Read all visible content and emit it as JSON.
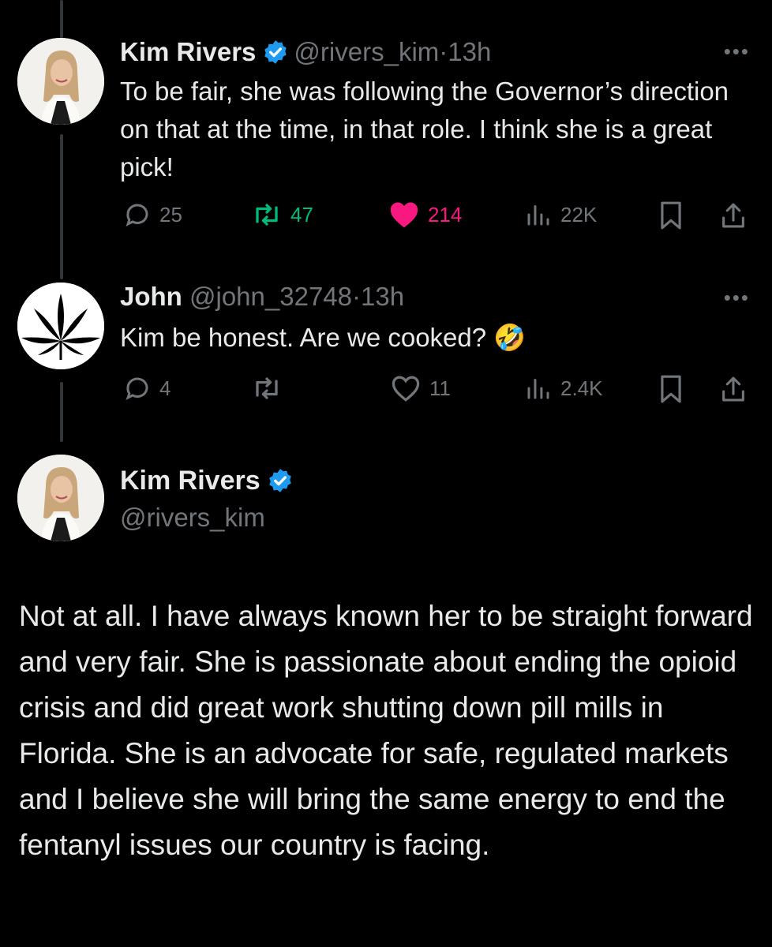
{
  "tweets": [
    {
      "name": "Kim Rivers",
      "handle": "@rivers_kim",
      "separator": "·",
      "time": "13h",
      "text": "To be fair, she was following the Governor’s direction on that at the time, in that role. I think she is a great pick!",
      "replies": "25",
      "reposts": "47",
      "likes": "214",
      "views": "22K",
      "more": "•••"
    },
    {
      "name": "John",
      "handle": "@john_32748",
      "separator": "·",
      "time": "13h",
      "text": "Kim be honest. Are we cooked? 🤣",
      "replies": "4",
      "reposts": "",
      "likes": "11",
      "views": "2.4K",
      "more": "•••"
    }
  ],
  "main_tweet": {
    "name": "Kim Rivers",
    "handle": "@rivers_kim",
    "text": "Not at all. I have always known her to be straight forward and very fair. She is passionate about ending the opioid crisis and did great work shutting down pill mills in Florida. She is an advocate for safe, regulated markets and I believe she will bring the same energy to end the fentanyl issues our country is facing."
  },
  "colors": {
    "background": "#000000",
    "text": "#e7e9ea",
    "secondary": "#71767b",
    "verified": "#1d9bf0",
    "repost_active": "#00ba7c",
    "like_active": "#f91880"
  }
}
